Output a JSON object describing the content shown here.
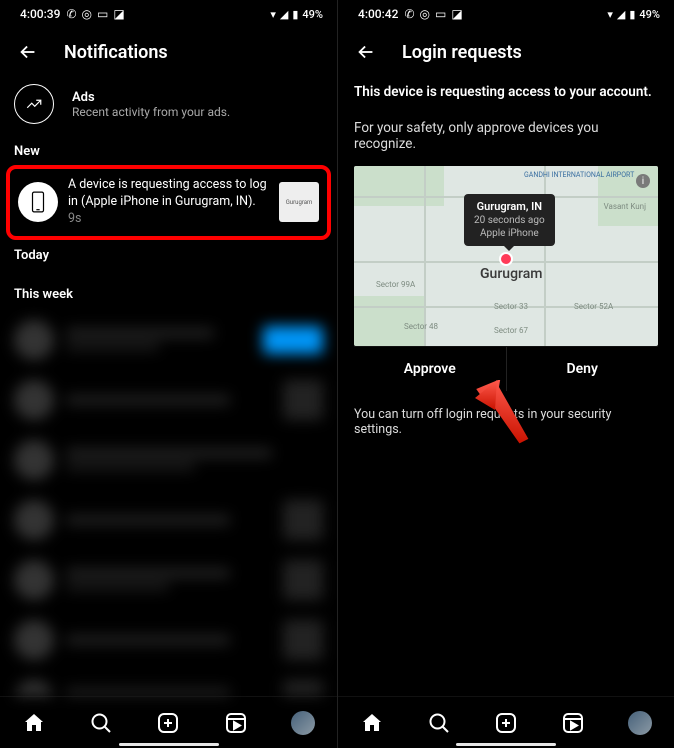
{
  "statusBar": {
    "time_left": "4:00:39",
    "time_right": "4:00:42",
    "battery_text": "49%"
  },
  "left": {
    "header_title": "Notifications",
    "ads_title": "Ads",
    "ads_sub": "Recent activity from your ads.",
    "section_new": "New",
    "login_request_text": "A device is requesting access to log in (Apple iPhone in Gurugram, IN).",
    "login_request_ts": "9s",
    "map_thumb_label": "Gurugram",
    "section_today": "Today",
    "section_week": "This week"
  },
  "right": {
    "header_title": "Login requests",
    "line1": "This device is requesting access to your account.",
    "line2": "For your safety, only approve devices you recognize.",
    "map": {
      "airport_label": "GANDHI\nINTERNATIONAL\nAIRPORT",
      "city_label": "Gurugram",
      "tooltip_place": "Gurugram, IN",
      "tooltip_time": "20 seconds ago",
      "tooltip_device": "Apple iPhone",
      "sectors": [
        "Vasant Kunj",
        "Sector 99A",
        "Sector 33",
        "Sector 52A",
        "Sector 48",
        "Sector 67"
      ]
    },
    "approve": "Approve",
    "deny": "Deny",
    "footer": "You can turn off login requests in your security settings."
  }
}
